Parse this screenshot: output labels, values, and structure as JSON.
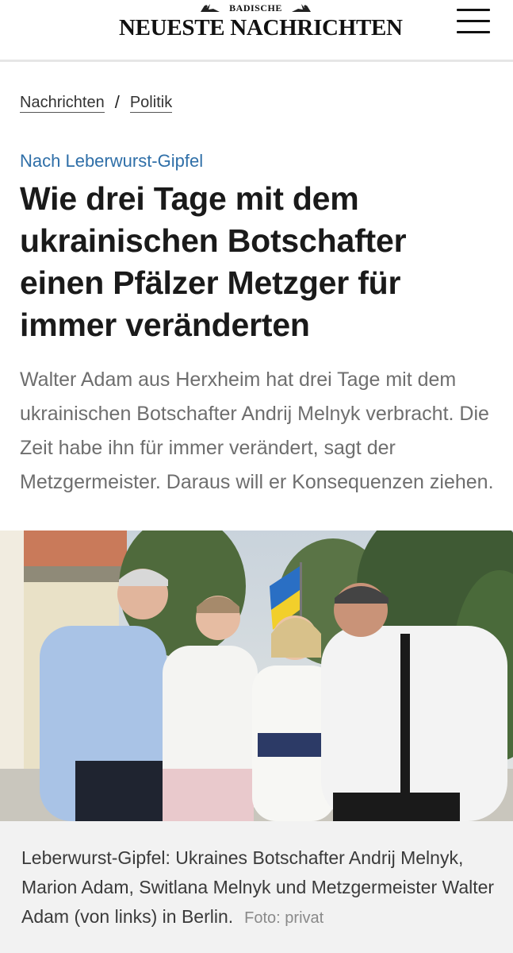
{
  "header": {
    "logo_small": "BADISCHE",
    "logo_main": "NEUESTE NACHRICHTEN",
    "menu_icon": "hamburger-menu-icon"
  },
  "breadcrumb": {
    "items": [
      "Nachrichten",
      "Politik"
    ],
    "separator": "/"
  },
  "article": {
    "kicker": "Nach Leberwurst-Gipfel",
    "headline": "Wie drei Tage mit dem ukrainischen Botschafter einen Pfälzer Metzger für immer veränderten",
    "teaser": "Walter Adam aus Herxheim hat drei Tage mit dem ukrainischen Botschafter Andrij Melnyk verbracht. Die Zeit habe ihn für immer verändert, sagt der Metzgermeister. Daraus will er Konsequenzen ziehen.",
    "caption": "Leberwurst-Gipfel: Ukraines Botschafter Andrij Melnyk, Marion Adam, Switlana Melnyk und Metzgermeister Walter Adam (von links) in Berlin.",
    "credit": "Foto: privat"
  },
  "colors": {
    "kicker": "#2f6fa8",
    "teaser": "#6e6e6e",
    "caption_bg": "#f2f2f2"
  }
}
